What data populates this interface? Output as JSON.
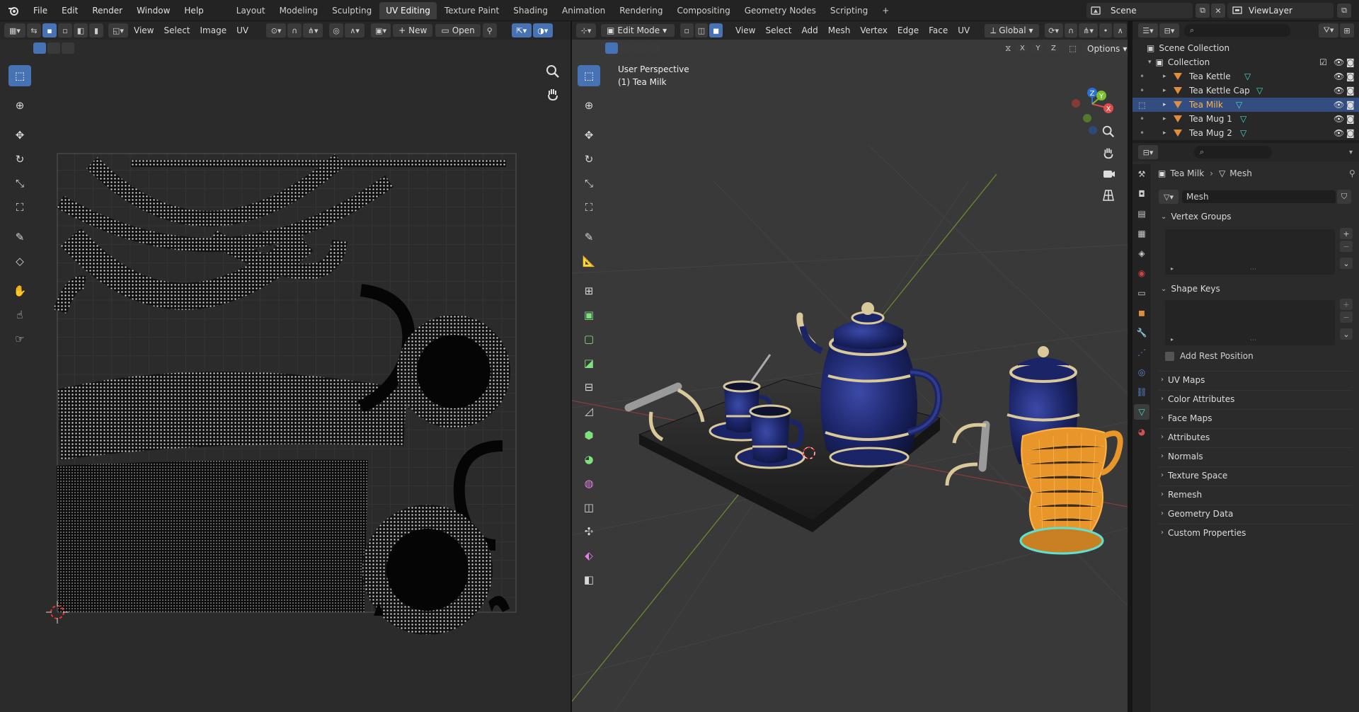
{
  "topbar": {
    "menus": [
      "File",
      "Edit",
      "Render",
      "Window",
      "Help"
    ],
    "workspaces": [
      "Layout",
      "Modeling",
      "Sculpting",
      "UV Editing",
      "Texture Paint",
      "Shading",
      "Animation",
      "Rendering",
      "Compositing",
      "Geometry Nodes",
      "Scripting"
    ],
    "active_workspace": "UV Editing",
    "add_tab": "+",
    "scene": "Scene",
    "view_layer": "ViewLayer"
  },
  "uv_editor": {
    "menus": [
      "View",
      "Select",
      "Image",
      "UV"
    ],
    "new_label": "New",
    "open_label": "Open"
  },
  "viewport": {
    "mode": "Edit Mode",
    "menus": [
      "View",
      "Select",
      "Add",
      "Mesh",
      "Vertex",
      "Edge",
      "Face",
      "UV"
    ],
    "orientation": "Global",
    "axes": [
      "X",
      "Y",
      "Z"
    ],
    "options": "Options",
    "overlay_title": "User Perspective",
    "overlay_object": "(1) Tea Milk"
  },
  "outliner": {
    "root": "Scene Collection",
    "collection": "Collection",
    "items": [
      "Tea Kettle",
      "Tea Kettle Cap",
      "Tea Milk",
      "Tea Mug 1",
      "Tea Mug 2"
    ],
    "selected": "Tea Milk"
  },
  "properties": {
    "breadcrumb_object": "Tea Milk",
    "breadcrumb_data": "Mesh",
    "datablock": "Mesh",
    "panels": {
      "vertex_groups": "Vertex Groups",
      "shape_keys": "Shape Keys",
      "add_rest_position": "Add Rest Position"
    },
    "collapsed": [
      "UV Maps",
      "Color Attributes",
      "Face Maps",
      "Attributes",
      "Normals",
      "Texture Space",
      "Remesh",
      "Geometry Data",
      "Custom Properties"
    ]
  },
  "colors": {
    "accent": "#4772b3",
    "selected_orange": "#f0a030",
    "mesh_teal": "#48d9c4",
    "navy": "#1e2a6a",
    "cream": "#d9c99a"
  }
}
